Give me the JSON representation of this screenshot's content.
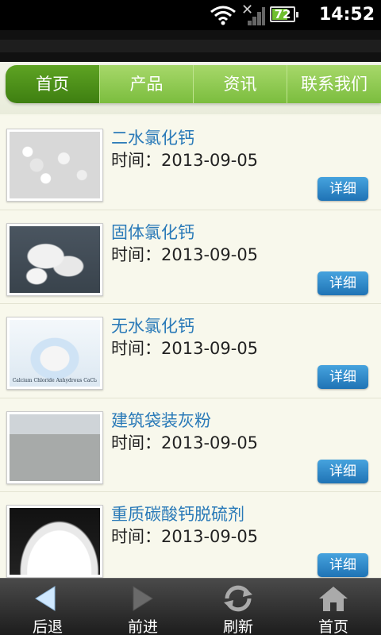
{
  "status_bar": {
    "time": "14:52",
    "battery": "72",
    "battery_level": 0.72
  },
  "tabs": [
    {
      "label": "首页",
      "active": true
    },
    {
      "label": "产品",
      "active": false
    },
    {
      "label": "资讯",
      "active": false
    },
    {
      "label": "联系我们",
      "active": false
    }
  ],
  "items": [
    {
      "title": "二水氯化钙",
      "date": "时间：2013-09-05",
      "button": "详细",
      "thumb_icon": "granules-image"
    },
    {
      "title": "固体氯化钙",
      "date": "时间：2013-09-05",
      "button": "详细",
      "thumb_icon": "solid-chunks-image"
    },
    {
      "title": "无水氯化钙",
      "date": "时间：2013-09-05",
      "button": "详细",
      "thumb_icon": "flask-image",
      "thumb_caption": "Calcium Chloride Anhydrous CaCl₂"
    },
    {
      "title": "建筑袋装灰粉",
      "date": "时间：2013-09-05",
      "button": "详细",
      "thumb_icon": "warehouse-image"
    },
    {
      "title": "重质碳酸钙脱硫剂",
      "date": "时间：2013-09-05",
      "button": "详细",
      "thumb_icon": "powder-image"
    }
  ],
  "bottom_nav": [
    {
      "label": "后退",
      "icon": "back-arrow-icon"
    },
    {
      "label": "前进",
      "icon": "forward-arrow-icon"
    },
    {
      "label": "刷新",
      "icon": "refresh-icon"
    },
    {
      "label": "首页",
      "icon": "home-icon"
    }
  ],
  "colors": {
    "tab_active": "#4a8f18",
    "tab_inactive": "#8fcb50",
    "link_blue": "#2a7ab8",
    "button_blue": "#2d86c8"
  }
}
